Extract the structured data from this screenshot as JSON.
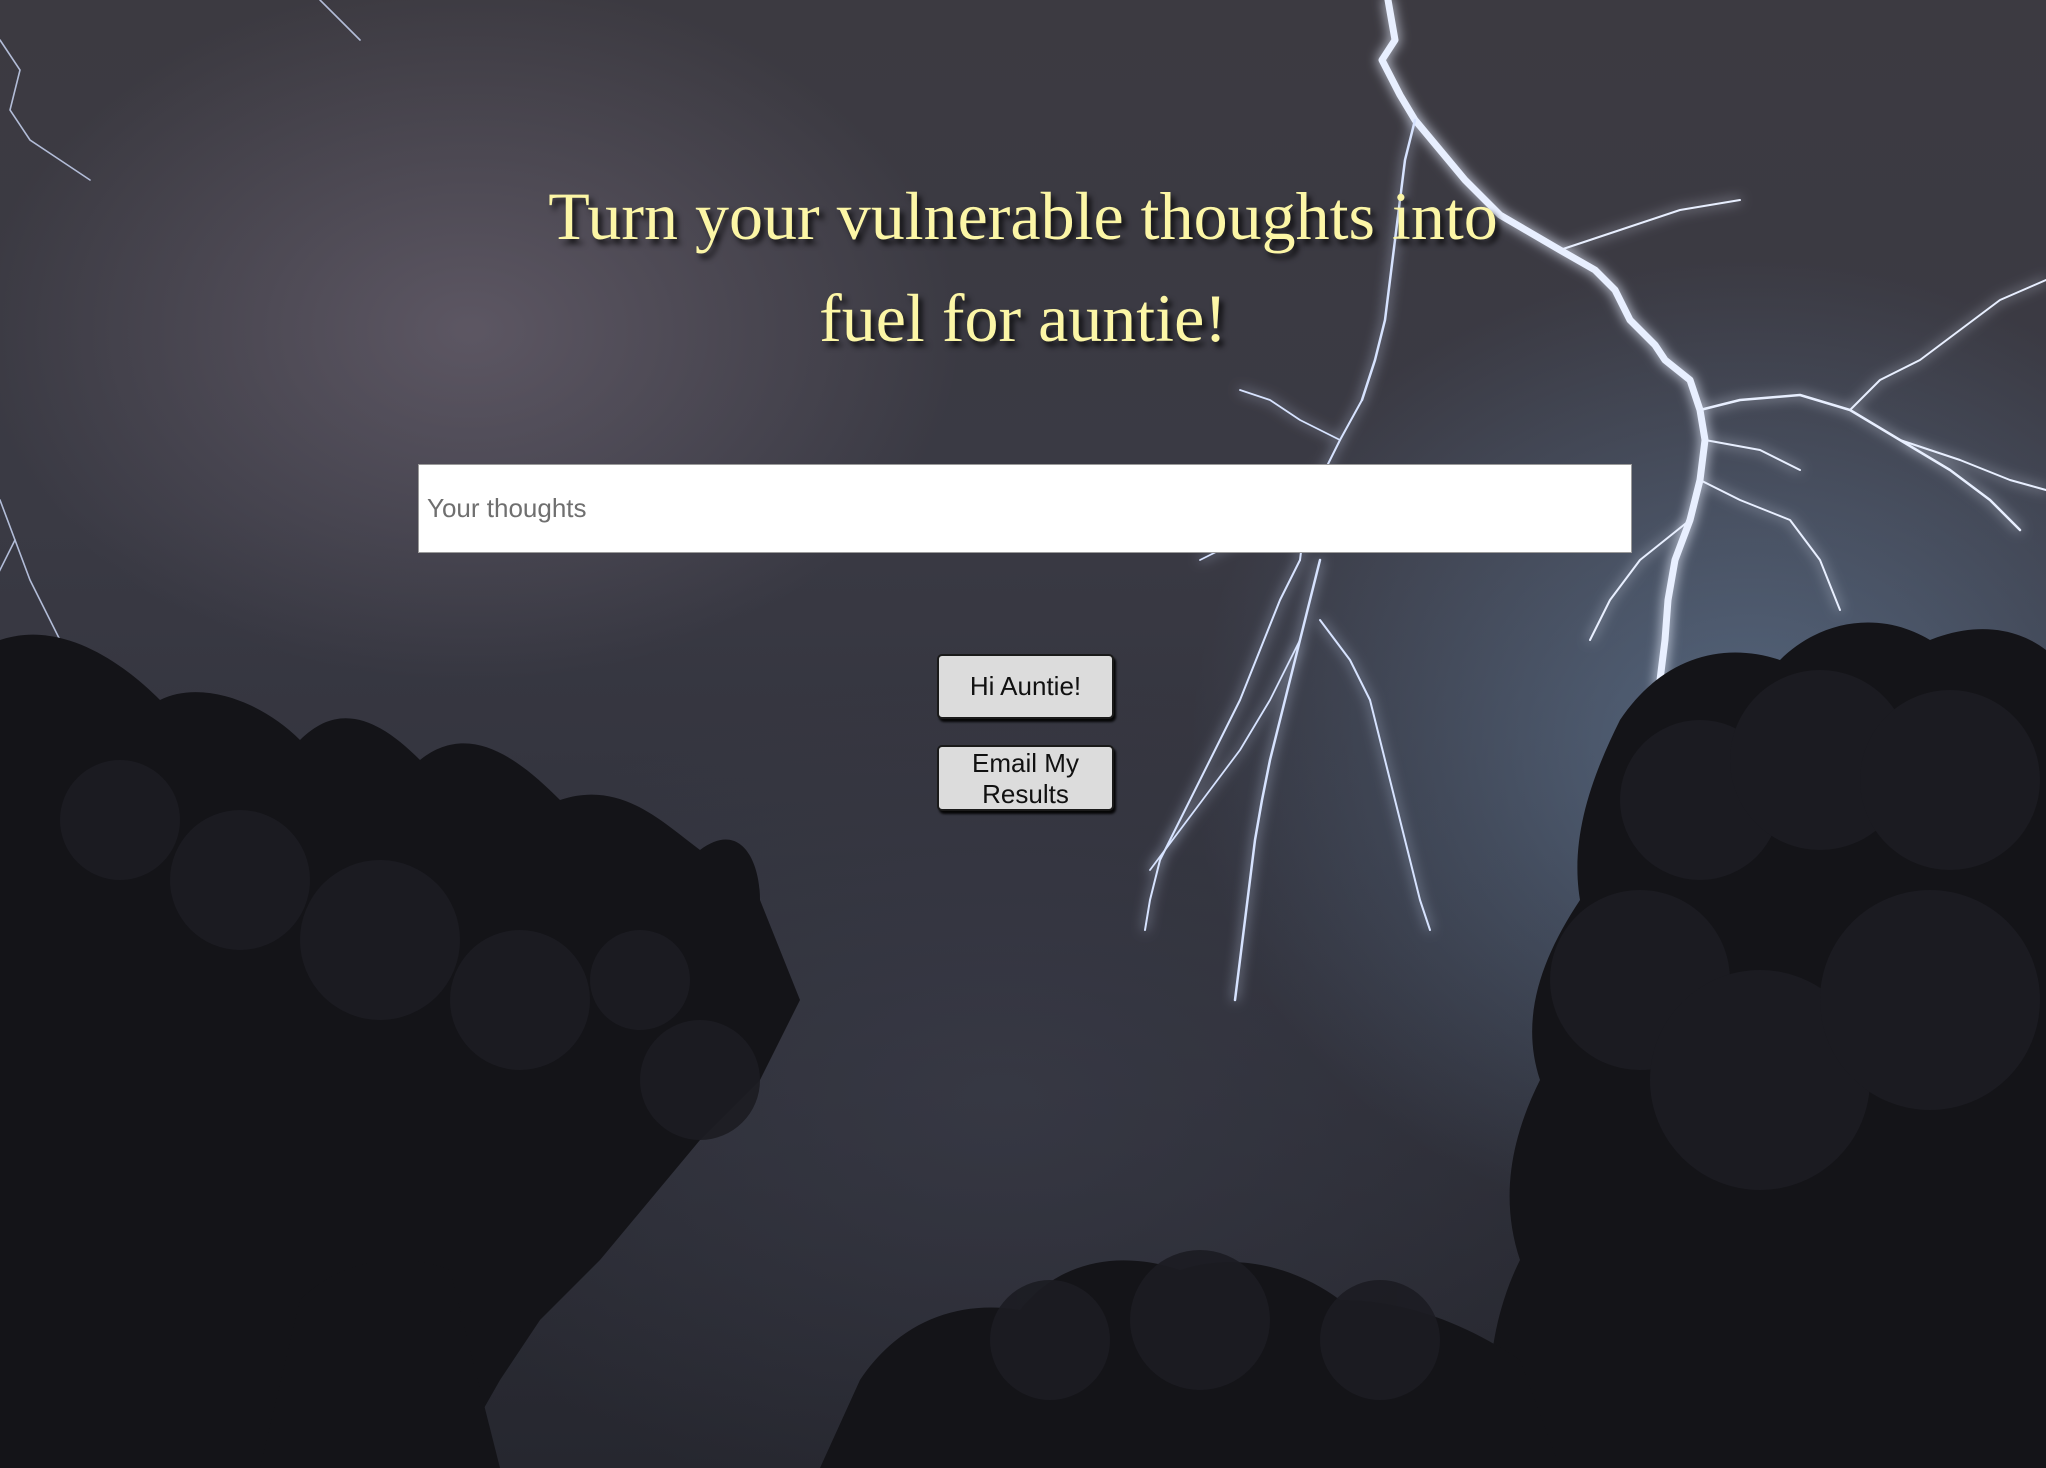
{
  "headline": {
    "line1": "Turn your vulnerable thoughts into",
    "line2": "fuel for auntie!"
  },
  "thoughts_input": {
    "placeholder": "Your thoughts",
    "value": ""
  },
  "buttons": {
    "hi_auntie": "Hi Auntie!",
    "email_results": "Email My Results"
  },
  "colors": {
    "headline": "#fcf6a6",
    "lightning": "#dfe9ff",
    "sky": "#35353e",
    "button_bg": "#dcdcdc"
  }
}
